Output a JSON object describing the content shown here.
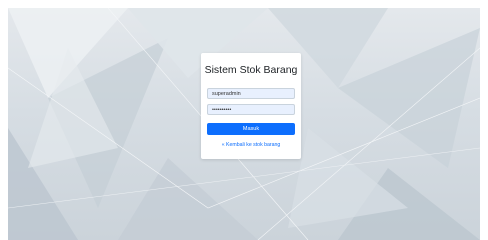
{
  "login": {
    "title": "Sistem Stok Barang",
    "username_value": "superadmin",
    "password_value": "••••••••••",
    "submit_label": "Masuk",
    "back_link": "« Kembali ke stok barang"
  },
  "colors": {
    "primary": "#0d6efd",
    "background": "#d6dde3",
    "input_autofill": "#e8f0fe"
  }
}
